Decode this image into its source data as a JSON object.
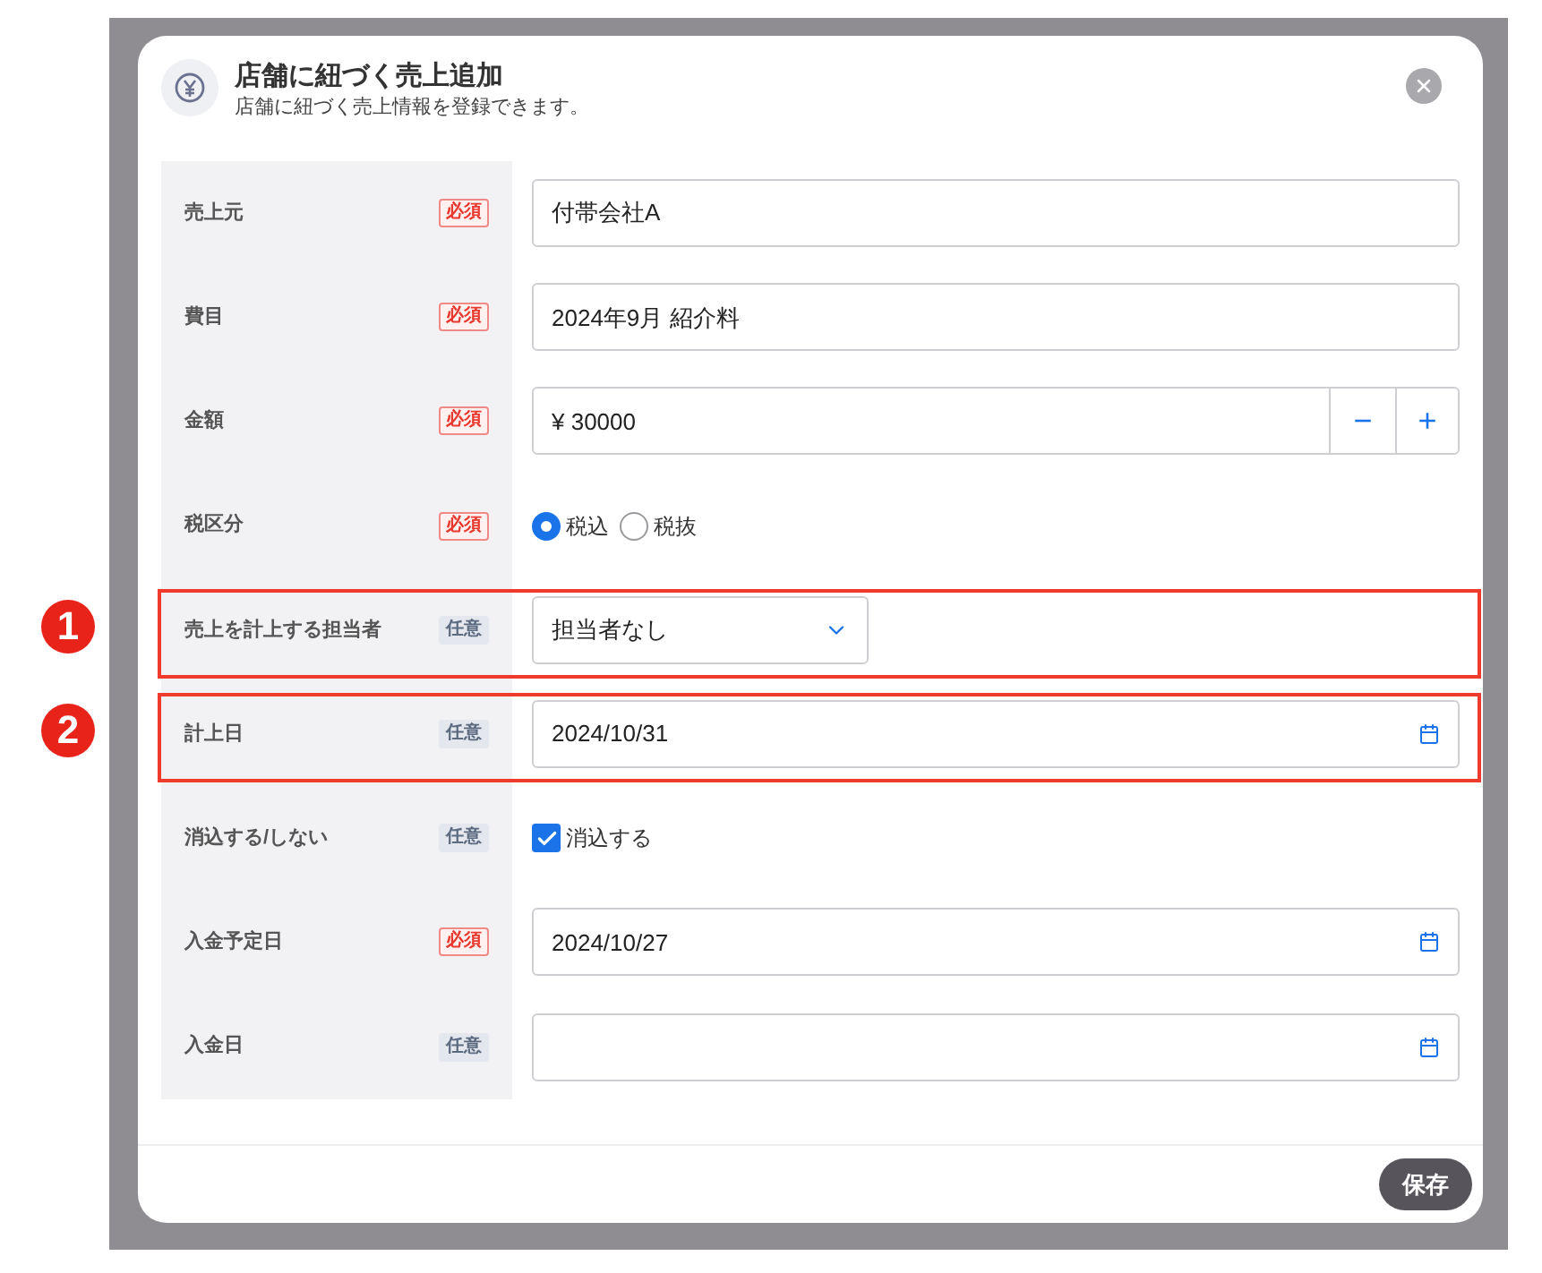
{
  "dialog": {
    "title": "店舗に紐づく売上追加",
    "subtitle": "店舗に紐づく売上情報を登録できます。"
  },
  "rows": [
    {
      "kind": "text",
      "label": "売上元",
      "required": true,
      "badge": "必須",
      "value": "付帯会社A"
    },
    {
      "kind": "text",
      "label": "費目",
      "required": true,
      "badge": "必須",
      "value": "2024年9月 紹介料"
    },
    {
      "kind": "number",
      "label": "金額",
      "required": true,
      "badge": "必須",
      "value": "¥ 30000",
      "minus": "−",
      "plus": "+"
    },
    {
      "kind": "radio",
      "label": "税区分",
      "required": true,
      "badge": "必須",
      "options": [
        {
          "label": "税込",
          "selected": true
        },
        {
          "label": "税抜",
          "selected": false
        }
      ]
    },
    {
      "kind": "select",
      "label": "売上を計上する担当者",
      "required": false,
      "badge": "任意",
      "value": "担当者なし",
      "marker": "1"
    },
    {
      "kind": "date",
      "label": "計上日",
      "required": false,
      "badge": "任意",
      "value": "2024/10/31",
      "marker": "2"
    },
    {
      "kind": "checkbox",
      "label": "消込する/しない",
      "required": false,
      "badge": "任意",
      "text": "消込する",
      "checked": true
    },
    {
      "kind": "date",
      "label": "入金予定日",
      "required": true,
      "badge": "必須",
      "value": "2024/10/27"
    },
    {
      "kind": "date",
      "label": "入金日",
      "required": false,
      "badge": "任意"
    }
  ],
  "save_button": "保存"
}
